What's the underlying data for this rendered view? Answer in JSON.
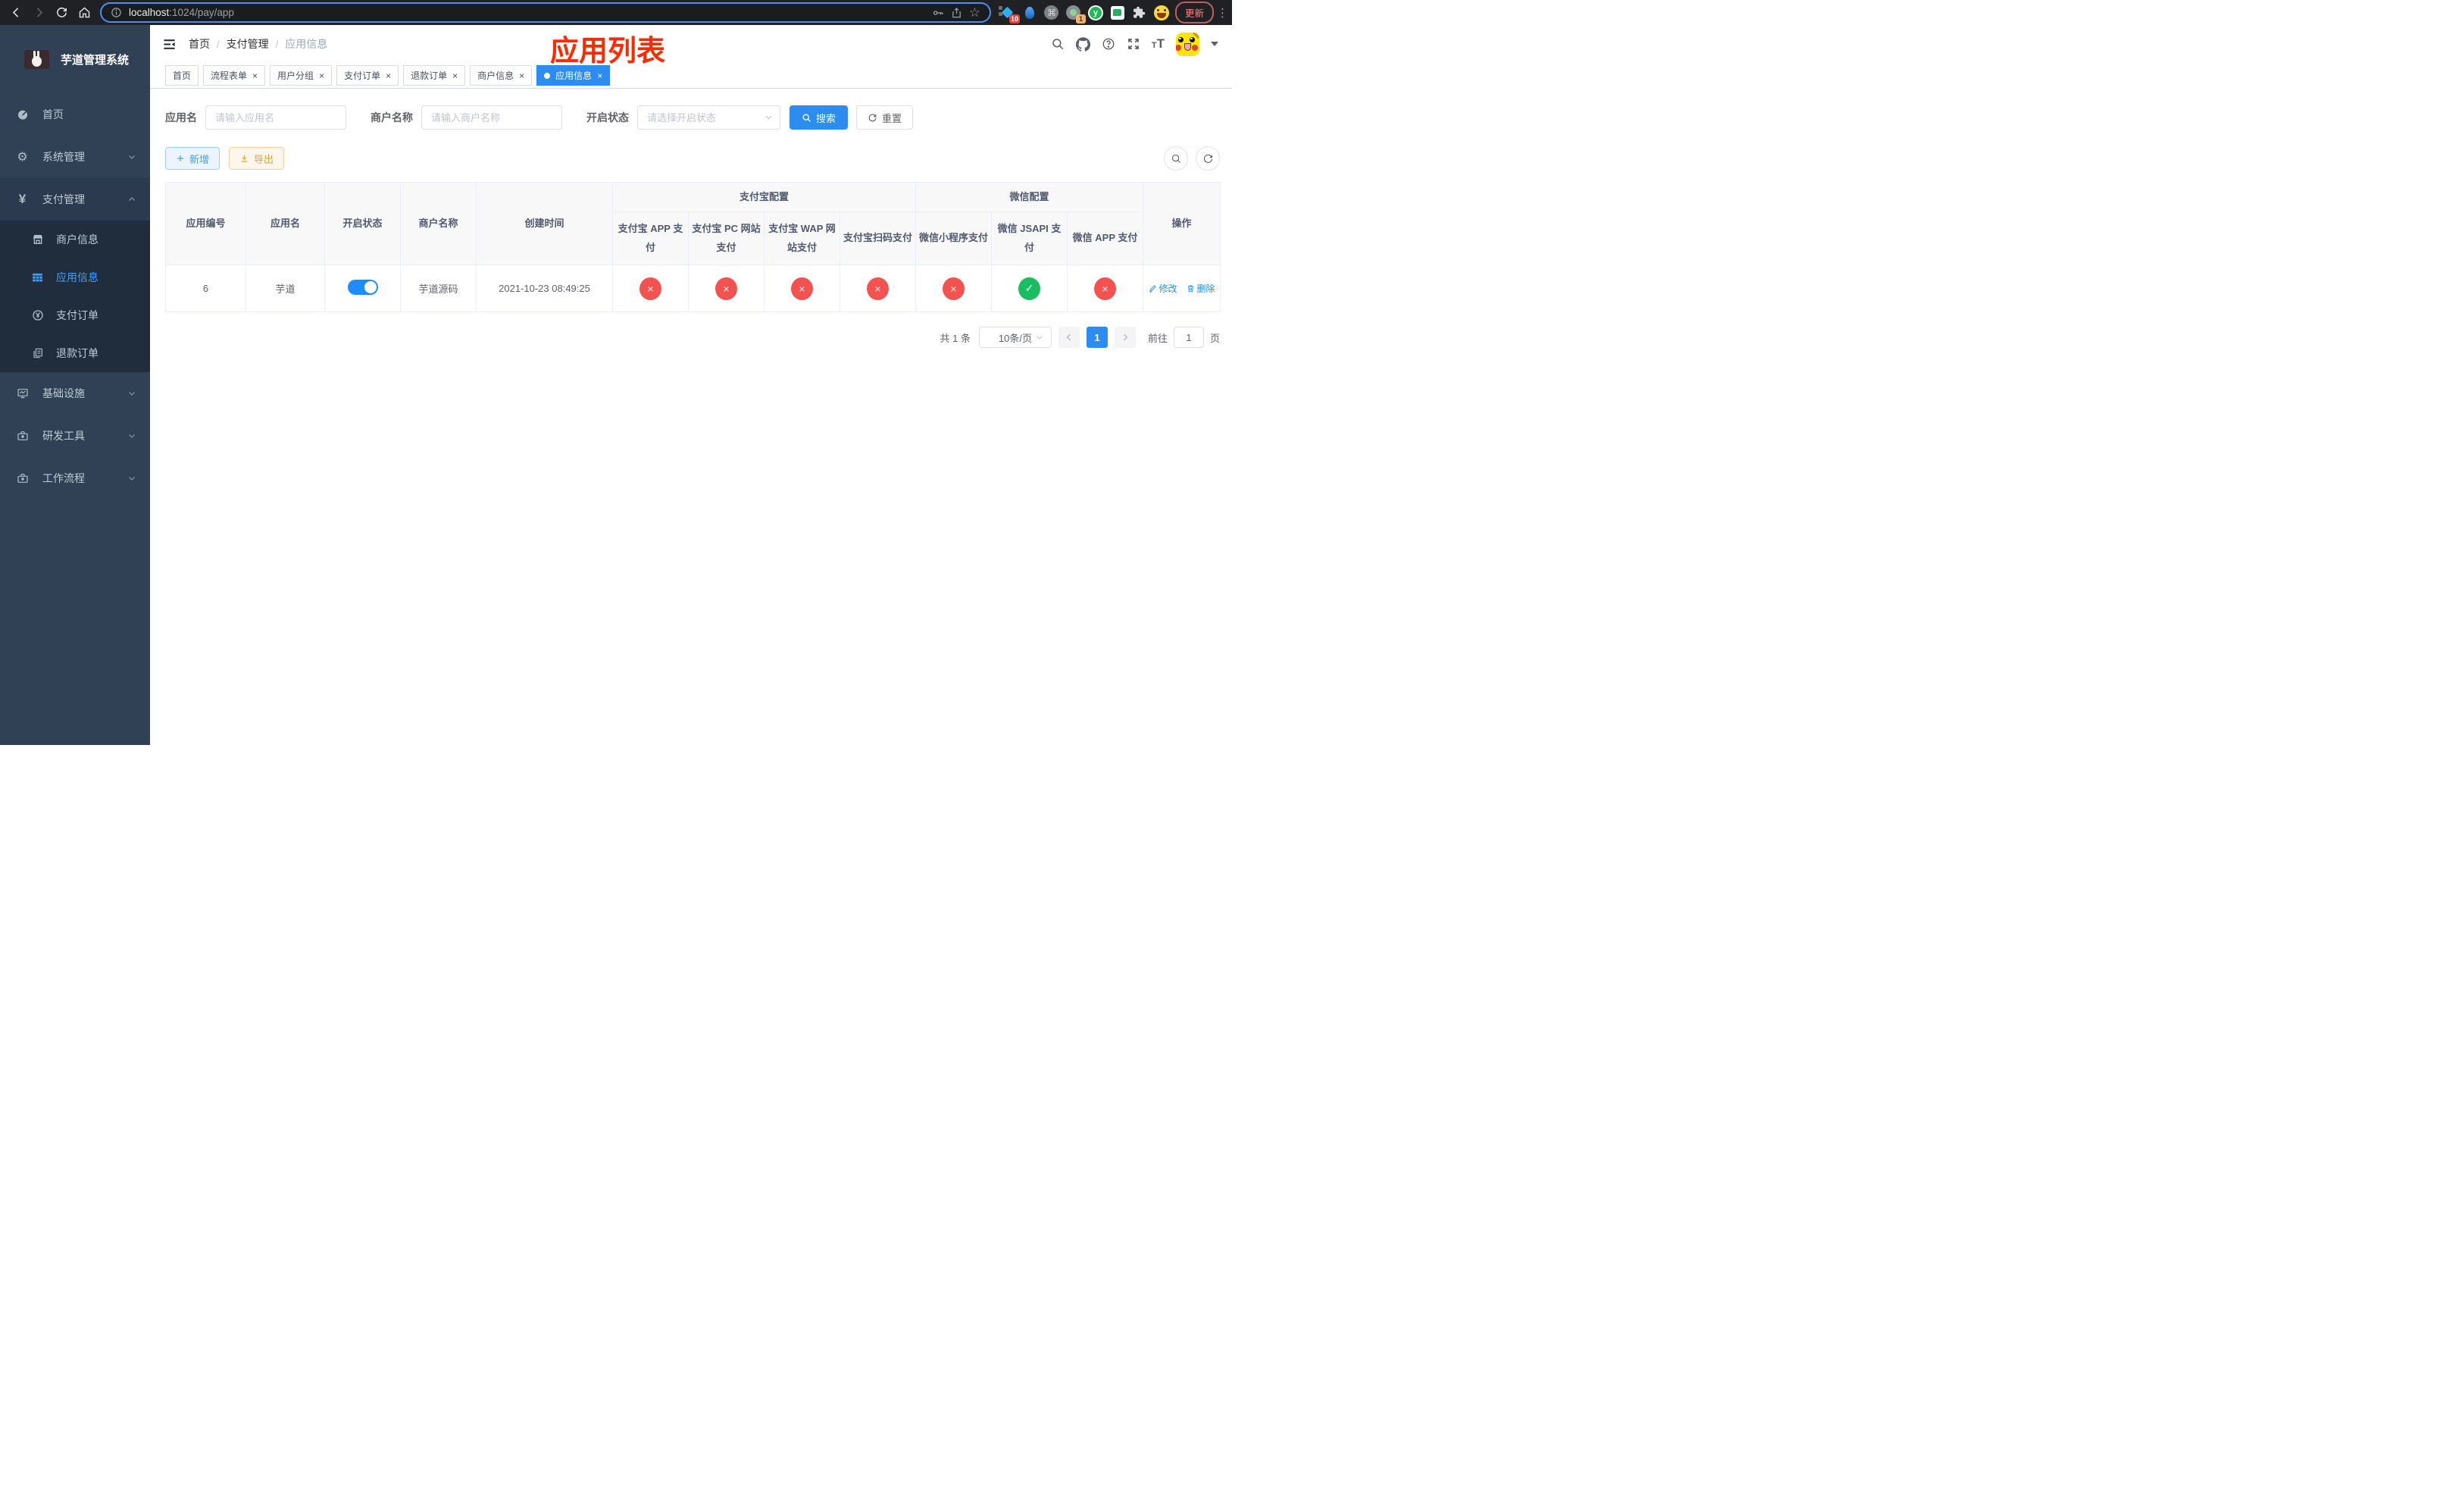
{
  "browser": {
    "url_host": "localhost",
    "url_rest": ":1024/pay/app",
    "update_button": "更新",
    "ext_badge_blue_diamond": "10",
    "ext_badge_grey_circle": "1",
    "ext_y_letter": "y"
  },
  "sidebar": {
    "title": "芋道管理系统",
    "items": [
      {
        "label": "首页"
      },
      {
        "label": "系统管理"
      },
      {
        "label": "支付管理"
      },
      {
        "label": "商户信息"
      },
      {
        "label": "应用信息"
      },
      {
        "label": "支付订单"
      },
      {
        "label": "退款订单"
      },
      {
        "label": "基础设施"
      },
      {
        "label": "研发工具"
      },
      {
        "label": "工作流程"
      }
    ]
  },
  "breadcrumb": {
    "items": [
      "首页",
      "支付管理",
      "应用信息"
    ]
  },
  "annotation": {
    "title": "应用列表",
    "color": "#ff2a00"
  },
  "tabs": [
    {
      "label": "首页"
    },
    {
      "label": "流程表单",
      "close": "×"
    },
    {
      "label": "用户分组",
      "close": "×"
    },
    {
      "label": "支付订单",
      "close": "×"
    },
    {
      "label": "退款订单",
      "close": "×"
    },
    {
      "label": "商户信息",
      "close": "×"
    },
    {
      "label": "应用信息",
      "close": "×"
    }
  ],
  "filters": {
    "app_name_label": "应用名",
    "app_name_placeholder": "请输入应用名",
    "merchant_label": "商户名称",
    "merchant_placeholder": "请输入商户名称",
    "status_label": "开启状态",
    "status_placeholder": "请选择开启状态",
    "search_button": "搜索",
    "reset_button": "重置"
  },
  "toolbar": {
    "add_button": "新增",
    "export_button": "导出"
  },
  "table": {
    "headers": {
      "app_id": "应用编号",
      "app_name": "应用名",
      "status": "开启状态",
      "merchant": "商户名称",
      "created": "创建时间",
      "alipay_group": "支付宝配置",
      "wechat_group": "微信配置",
      "alipay_app": "支付宝 APP 支付",
      "alipay_pc": "支付宝 PC 网站支付",
      "alipay_wap": "支付宝 WAP 网站支付",
      "alipay_qr": "支付宝扫码支付",
      "wx_mini": "微信小程序支付",
      "wx_jsapi": "微信 JSAPI 支付",
      "wx_app": "微信 APP 支付",
      "actions": "操作"
    },
    "rows": [
      {
        "app_id": "6",
        "app_name": "芋道",
        "merchant": "芋道源码",
        "created": "2021-10-23 08:49:25",
        "configs": [
          {
            "glyph": "×",
            "state_class": "status-off"
          },
          {
            "glyph": "×",
            "state_class": "status-off"
          },
          {
            "glyph": "×",
            "state_class": "status-off"
          },
          {
            "glyph": "×",
            "state_class": "status-off"
          },
          {
            "glyph": "×",
            "state_class": "status-off"
          },
          {
            "glyph": "✓",
            "state_class": "status-on"
          },
          {
            "glyph": "×",
            "state_class": "status-off"
          }
        ],
        "edit_label": "修改",
        "delete_label": "删除"
      }
    ]
  },
  "pagination": {
    "total": "共 1 条",
    "page_size": "10条/页",
    "current_page": "1",
    "goto_label": "前往",
    "goto_value": "1",
    "page_suffix": "页"
  },
  "colors": {
    "primary": "#2d8cf0",
    "sidebar_bg": "#304156",
    "submenu_bg": "#1f2d3d",
    "status_off": "#f35350",
    "status_on": "#1abd61",
    "annotation_red": "#ff2a00"
  }
}
